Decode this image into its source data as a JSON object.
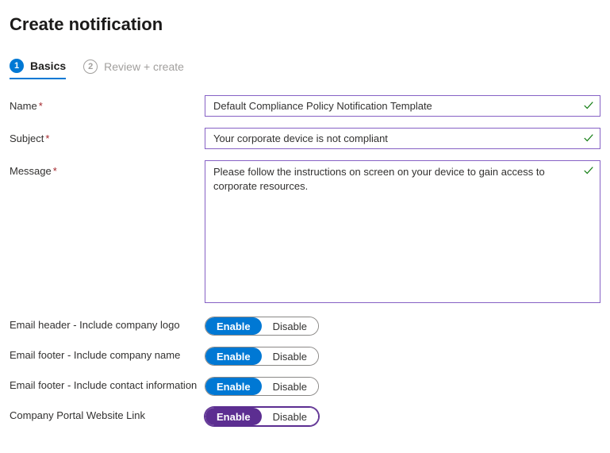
{
  "page": {
    "title": "Create notification"
  },
  "tabs": {
    "basics": {
      "num": "1",
      "label": "Basics"
    },
    "review": {
      "num": "2",
      "label": "Review + create"
    }
  },
  "fields": {
    "name": {
      "label": "Name",
      "required": "*",
      "value": "Default Compliance Policy Notification Template"
    },
    "subject": {
      "label": "Subject",
      "required": "*",
      "value": "Your corporate device is not compliant"
    },
    "message": {
      "label": "Message",
      "required": "*",
      "value": "Please follow the instructions on screen on your device to gain access to corporate resources."
    }
  },
  "toggles": {
    "header_logo": {
      "label": "Email header - Include company logo",
      "enable": "Enable",
      "disable": "Disable"
    },
    "footer_name": {
      "label": "Email footer - Include company name",
      "enable": "Enable",
      "disable": "Disable"
    },
    "footer_contact": {
      "label": "Email footer - Include contact information",
      "enable": "Enable",
      "disable": "Disable"
    },
    "portal_link": {
      "label": "Company Portal Website Link",
      "enable": "Enable",
      "disable": "Disable"
    }
  }
}
